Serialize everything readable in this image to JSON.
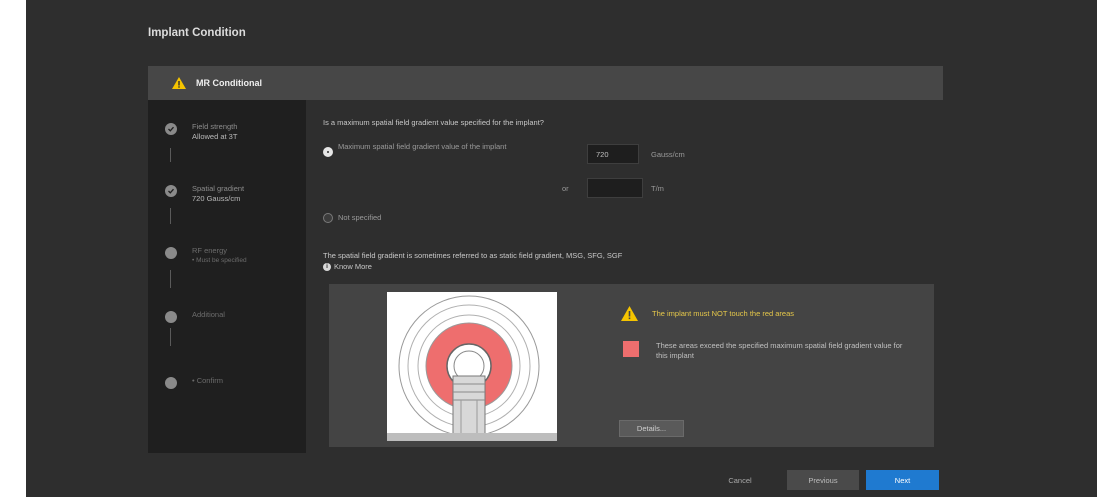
{
  "page": {
    "title": "Implant Condition"
  },
  "banner": {
    "label": "MR Conditional",
    "icon": "warning-icon",
    "accent": "#f5c400"
  },
  "steps": [
    {
      "title": "Field strength",
      "value": "Allowed at 3T",
      "state": "done"
    },
    {
      "title": "Spatial gradient",
      "value": "720 Gauss/cm",
      "state": "done"
    },
    {
      "title": "RF energy",
      "value": "• Must be specified",
      "state": "pending"
    },
    {
      "title": "Additional",
      "value": "",
      "state": "pending"
    },
    {
      "title": "• Confirm",
      "value": "",
      "state": "pending"
    }
  ],
  "question": "Is a maximum spatial field gradient value specified for the implant?",
  "options": {
    "specified": {
      "label": "Maximum spatial field gradient value of the implant",
      "selected": true
    },
    "gauss": {
      "value": "720",
      "unit": "Gauss/cm"
    },
    "or_label": "or",
    "tesla": {
      "value": "",
      "unit": "T/m"
    },
    "not_specified": {
      "label": "Not specified",
      "selected": false
    }
  },
  "note": "The spatial field gradient is sometimes referred to as static field gradient, MSG, SFG, SGF",
  "know_more": "Know More",
  "diagram": {
    "warning": "The implant must NOT touch the red areas",
    "legend": "These areas exceed the specified maximum spatial field gradient value for this implant",
    "legend_color": "#ee6e6e",
    "details_button": "Details..."
  },
  "footer": {
    "cancel": "Cancel",
    "previous": "Previous",
    "next": "Next"
  },
  "colors": {
    "primary": "#1f7ad0",
    "warning": "#e6c84a",
    "red_area": "#ee6e6e"
  }
}
